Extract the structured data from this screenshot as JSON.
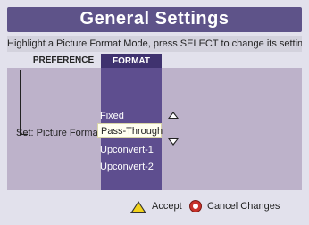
{
  "header": {
    "title": "General Settings",
    "instructions": "Highlight a Picture Format Mode, press SELECT to change its setting."
  },
  "tabs": {
    "preference": "PREFERENCE",
    "format": "FORMAT"
  },
  "setting": {
    "label": "Set: Picture Format",
    "options": [
      "Fixed",
      "Pass-Through",
      "Upconvert-1",
      "Upconvert-2"
    ],
    "selected": "Pass-Through"
  },
  "footer": {
    "accept_label": "Accept",
    "cancel_label": "Cancel Changes"
  },
  "colors": {
    "title_bar": "#5e5389",
    "format_column": "#5e4e8f",
    "content_bg": "#bdb2ca",
    "accept_icon": "#f2d21a",
    "cancel_icon": "#c8312a"
  },
  "icons": {
    "accept": "yellow-triangle-a-icon",
    "cancel": "red-circle-c-icon",
    "scroll_up": "arrow-up-icon",
    "scroll_down": "arrow-down-icon"
  }
}
